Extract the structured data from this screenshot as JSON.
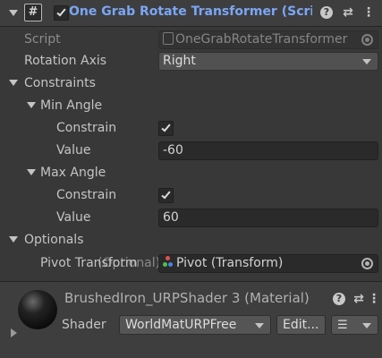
{
  "component": {
    "title": "One Grab Rotate Transformer (Script)",
    "enabled": true,
    "script_label": "Script",
    "script_value": "OneGrabRotateTransformer"
  },
  "rotation_axis": {
    "label": "Rotation Axis",
    "value": "Right"
  },
  "constraints": {
    "label": "Constraints",
    "min_angle": {
      "label": "Min Angle",
      "constrain_label": "Constrain",
      "constrain": true,
      "value_label": "Value",
      "value": "-60"
    },
    "max_angle": {
      "label": "Max Angle",
      "constrain_label": "Constrain",
      "constrain": true,
      "value_label": "Value",
      "value": "60"
    }
  },
  "optionals": {
    "label": "Optionals",
    "pivot_label": "Pivot Transform",
    "pivot_overlap": "(Optional)",
    "pivot_value": "Pivot (Transform)"
  },
  "material": {
    "title": "BrushedIron_URPShader 3 (Material)",
    "shader_label": "Shader",
    "shader_value": "WorldMatURPFree",
    "edit_label": "Edit..."
  },
  "colors": {
    "title_blue": "#7ba6f5",
    "background": "#383838",
    "header": "#3e3e3e"
  }
}
